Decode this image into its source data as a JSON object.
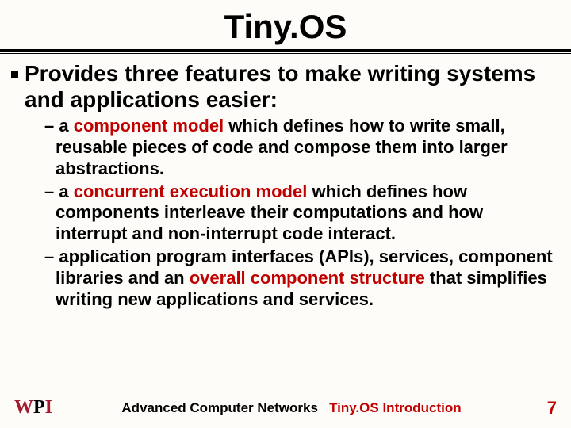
{
  "title": "Tiny.OS",
  "lead": "Provides three features to make writing systems and applications easier:",
  "items": [
    {
      "pre": "a ",
      "em": "component model",
      "post": " which defines how to write small, reusable pieces of code and compose them into larger abstractions."
    },
    {
      "pre": "a ",
      "em": "concurrent execution model",
      "post": " which defines how components interleave their computations and how interrupt and non-interrupt code interact."
    },
    {
      "pre": "application program interfaces (APIs), services, component libraries and an ",
      "em": "overall component structure",
      "post": " that simplifies writing new applications and services."
    }
  ],
  "footer": {
    "logo": {
      "w": "W",
      "p": "P",
      "i": "I"
    },
    "course": "Advanced Computer Networks",
    "topic": "Tiny.OS Introduction",
    "page": "7"
  }
}
